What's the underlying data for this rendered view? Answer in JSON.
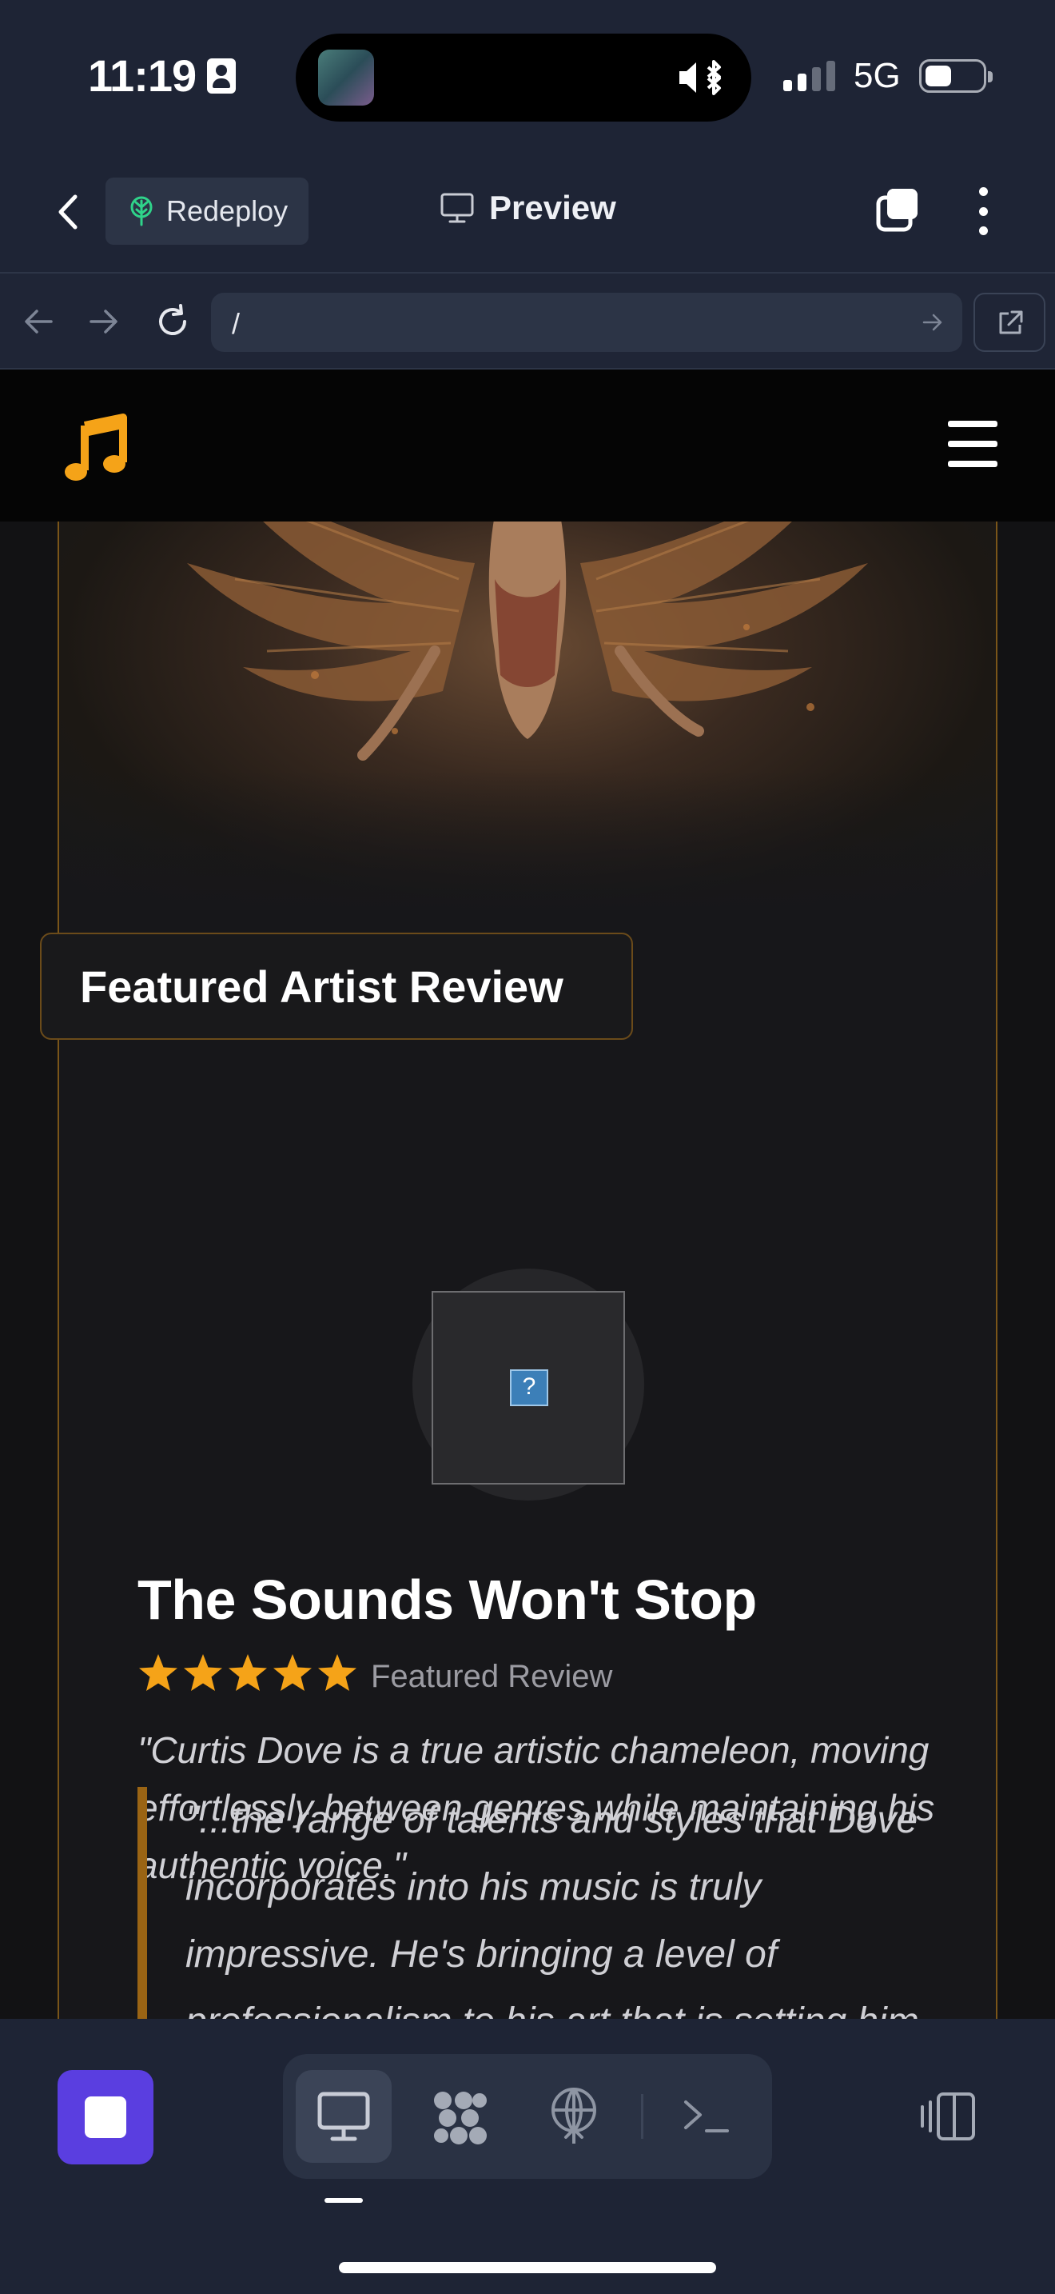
{
  "status_bar": {
    "time": "11:19",
    "network": "5G",
    "battery_level": 0.3,
    "signal_bars_active": 2,
    "signal_bars_total": 4
  },
  "app_header": {
    "redeploy_label": "Redeploy",
    "preview_label": "Preview"
  },
  "browser": {
    "url": "/"
  },
  "site": {
    "accent_color": "#f5a318",
    "badge": "Featured Artist Review",
    "review_title": "The Sounds Won't Stop",
    "rating": 5,
    "rating_max": 5,
    "review_tag": "Featured Review",
    "summary": "\"Curtis Dove is a true artistic chameleon, moving effortlessly between genres while maintaining his authentic voice.\"",
    "quote": "\"...the range of talents and styles that Dove incorporates into his music is truly impressive. He's bringing a level of professionalism to his art that is setting him up for some bigger stages as his",
    "avatar_placeholder": "?"
  },
  "toolbar": {
    "active_mode": "preview",
    "stop_color": "#5a3ee0"
  }
}
